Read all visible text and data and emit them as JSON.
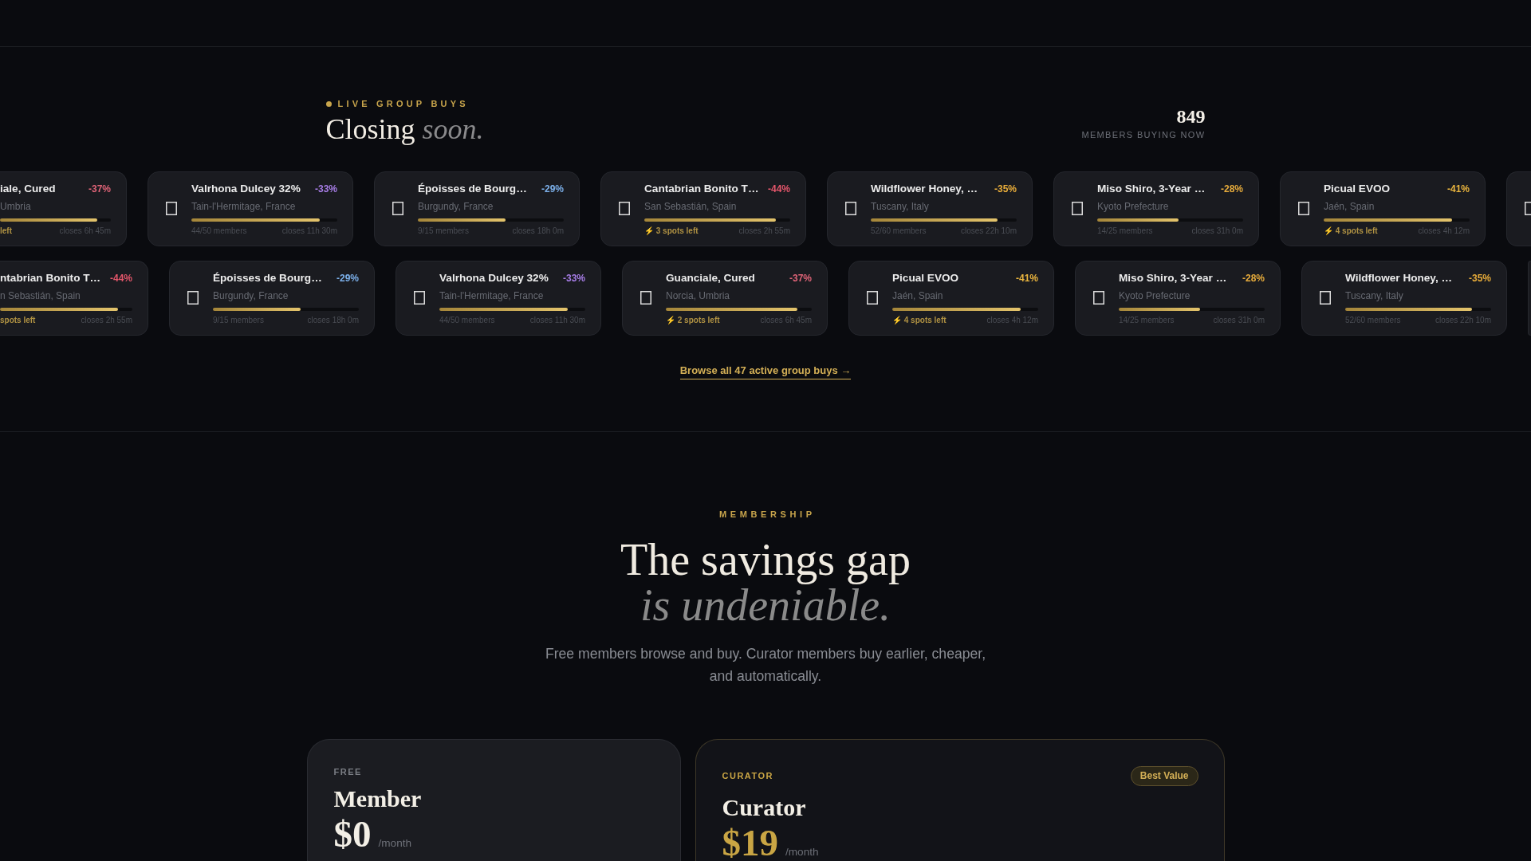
{
  "live": {
    "eyebrow": "LIVE GROUP BUYS",
    "title": "Closing *soon.*",
    "stat_value": "849",
    "stat_label": "MEMBERS BUYING NOW"
  },
  "rows": [
    {
      "cards": [
        {
          "kind": "partial",
          "title": "iale, Cured",
          "discount": "-37%",
          "color": "#e06478",
          "origin": "Umbria",
          "level": 0.88,
          "status": "left",
          "urgent": true,
          "closes": "closes 6h 45m"
        },
        {
          "kind": "full",
          "title": "Valrhona Dulcey 32%",
          "discount": "-33%",
          "color": "#a77de6",
          "origin": "Tain-l'Hermitage, France",
          "level": 0.88,
          "status": "44/50 members",
          "urgent": false,
          "closes": "closes 11h 30m"
        },
        {
          "kind": "full",
          "title": "Époisses de Bourg…",
          "discount": "-29%",
          "color": "#7cb0ea",
          "origin": "Burgundy, France",
          "level": 0.6,
          "status": "9/15 members",
          "urgent": false,
          "closes": "closes 18h 0m"
        },
        {
          "kind": "full",
          "title": "Cantabrian Bonito T…",
          "discount": "-44%",
          "color": "#e4566b",
          "origin": "San Sebastián, Spain",
          "level": 0.9,
          "status": "⚡ 3 spots left",
          "urgent": true,
          "closes": "closes 2h 55m"
        },
        {
          "kind": "full",
          "title": "Wildflower Honey, …",
          "discount": "-35%",
          "color": "#e9ad3a",
          "origin": "Tuscany, Italy",
          "level": 0.867,
          "status": "52/60 members",
          "urgent": false,
          "closes": "closes 22h 10m"
        },
        {
          "kind": "full",
          "title": "Miso Shiro, 3-Year …",
          "discount": "-28%",
          "color": "#e6ab3c",
          "origin": "Kyoto Prefecture",
          "level": 0.56,
          "status": "14/25 members",
          "urgent": false,
          "closes": "closes 31h 0m"
        },
        {
          "kind": "full",
          "title": "Picual EVOO",
          "discount": "-41%",
          "color": "#eab53e",
          "origin": "Jaén, Spain",
          "level": 0.88,
          "status": "⚡ 4 spots left",
          "urgent": true,
          "closes": "closes 4h 12m"
        },
        {
          "kind": "edge"
        }
      ]
    },
    {
      "cards": [
        {
          "kind": "partial",
          "title": "ntabrian Bonito T…",
          "discount": "-44%",
          "color": "#e4566b",
          "origin": "n Sebastián, Spain",
          "level": 0.89,
          "status": "spots left",
          "urgent": true,
          "closes": "closes 2h 55m"
        },
        {
          "kind": "full",
          "title": "Époisses de Bourg…",
          "discount": "-29%",
          "color": "#7cb0ea",
          "origin": "Burgundy, France",
          "level": 0.6,
          "status": "9/15 members",
          "urgent": false,
          "closes": "closes 18h 0m"
        },
        {
          "kind": "full",
          "title": "Valrhona Dulcey 32%",
          "discount": "-33%",
          "color": "#a77de6",
          "origin": "Tain-l'Hermitage, France",
          "level": 0.88,
          "status": "44/50 members",
          "urgent": false,
          "closes": "closes 11h 30m"
        },
        {
          "kind": "full",
          "title": "Guanciale, Cured",
          "discount": "-37%",
          "color": "#e06478",
          "origin": "Norcia, Umbria",
          "level": 0.9,
          "status": "⚡ 2 spots left",
          "urgent": true,
          "closes": "closes 6h 45m"
        },
        {
          "kind": "full",
          "title": "Picual EVOO",
          "discount": "-41%",
          "color": "#eab53e",
          "origin": "Jaén, Spain",
          "level": 0.88,
          "status": "⚡ 4 spots left",
          "urgent": true,
          "closes": "closes 4h 12m"
        },
        {
          "kind": "full",
          "title": "Miso Shiro, 3-Year …",
          "discount": "-28%",
          "color": "#e6ab3c",
          "origin": "Kyoto Prefecture",
          "level": 0.56,
          "status": "14/25 members",
          "urgent": false,
          "closes": "closes 31h 0m"
        },
        {
          "kind": "full",
          "title": "Wildflower Honey, …",
          "discount": "-35%",
          "color": "#e9ad3a",
          "origin": "Tuscany, Italy",
          "level": 0.867,
          "status": "52/60 members",
          "urgent": false,
          "closes": "closes 22h 10m"
        },
        {
          "kind": "sliver"
        }
      ]
    }
  ],
  "browse_link": "Browse all 47 active group buys →",
  "membership": {
    "eyebrow": "MEMBERSHIP",
    "title": "The savings gap *is undeniable.*",
    "subtitle": "Free members browse and buy. Curator members buy earlier, cheaper, and automatically."
  },
  "plans": [
    {
      "tier": "FREE",
      "name": "Member",
      "price": "$0",
      "period": "/month",
      "featured": false
    },
    {
      "tier": "CURATOR",
      "badge": "Best Value",
      "name": "Curator",
      "price": "$19",
      "period": "/month",
      "featured": true
    }
  ]
}
